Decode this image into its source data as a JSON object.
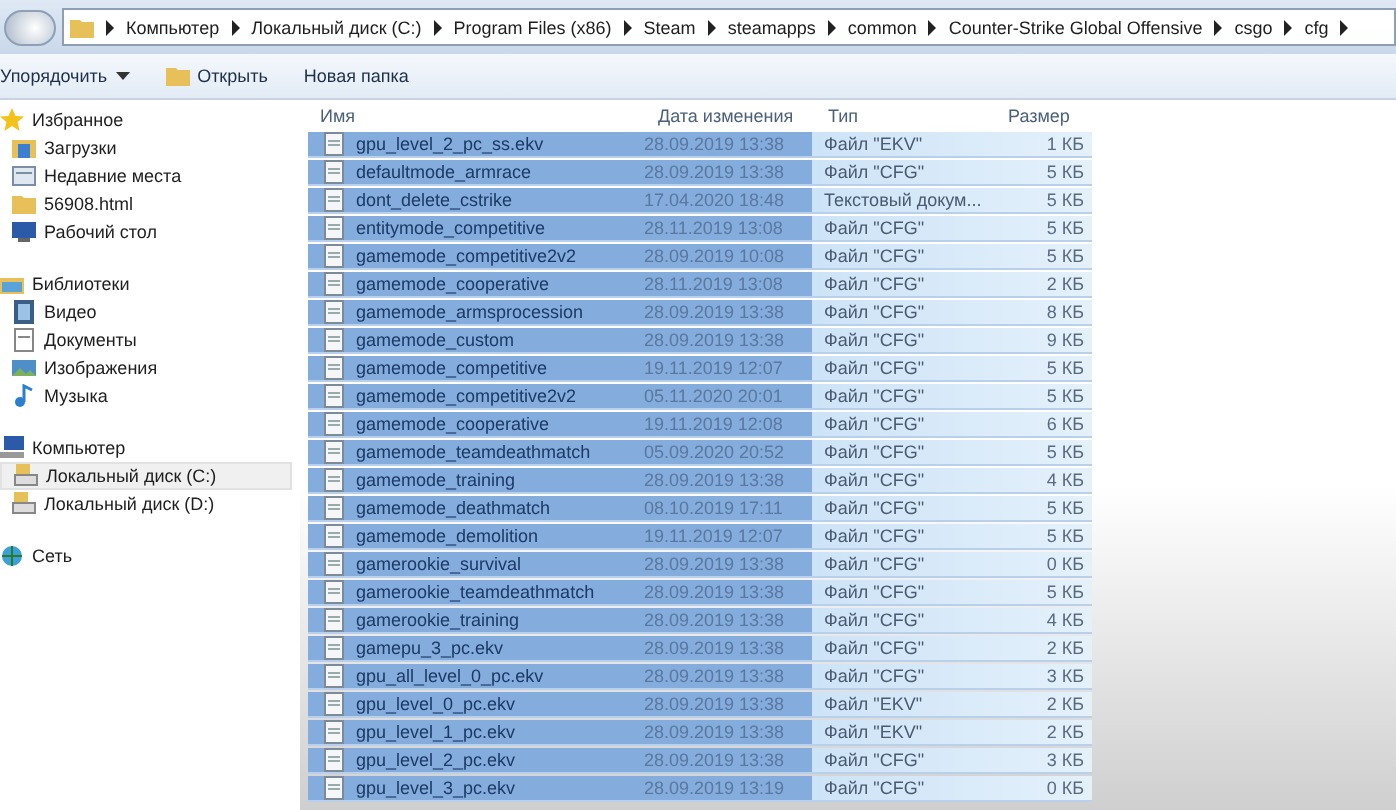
{
  "address_bar": {
    "path": [
      "Компьютер",
      "Локальный диск (C:)",
      "Program Files (x86)",
      "Steam",
      "steamapps",
      "common",
      "Counter-Strike Global Offensive",
      "csgo",
      "cfg"
    ]
  },
  "toolbar": {
    "buttons": [
      {
        "label": "Упорядочить",
        "kind": "menu"
      },
      {
        "label": "Открыть",
        "kind": "open"
      },
      {
        "label": "Новая папка",
        "kind": "plain"
      }
    ]
  },
  "sidebar": {
    "groups": [
      {
        "label": "Избранное",
        "kind": "star",
        "children": [
          {
            "label": "Загрузки",
            "kind": "download",
            "selected": false
          },
          {
            "label": "Недавние места",
            "kind": "recent",
            "selected": false
          },
          {
            "label": "56908.html",
            "kind": "folder",
            "selected": false
          },
          {
            "label": "Рабочий стол",
            "kind": "desktop",
            "selected": false
          }
        ]
      },
      {
        "label": "Библиотеки",
        "kind": "library",
        "children": [
          {
            "label": "Видео",
            "kind": "video",
            "selected": false
          },
          {
            "label": "Документы",
            "kind": "document",
            "selected": false
          },
          {
            "label": "Изображения",
            "kind": "image",
            "selected": false
          },
          {
            "label": "Музыка",
            "kind": "music",
            "selected": false
          }
        ]
      },
      {
        "label": "Компьютер",
        "kind": "computer",
        "children": [
          {
            "label": "Локальный диск (C:)",
            "kind": "drive",
            "selected": true
          },
          {
            "label": "Локальный диск (D:)",
            "kind": "drive",
            "selected": false
          }
        ]
      },
      {
        "label": "Сеть",
        "kind": "network"
      }
    ]
  },
  "table": {
    "columns": [
      "Имя",
      "Дата изменения",
      "Тип",
      "Размер"
    ],
    "rows": [
      {
        "name": "gpu_level_2_pc_ss.ekv",
        "date": "28.09.2019 13:38",
        "type": "Файл \"EKV\"",
        "size": "1 КБ",
        "selected": true
      },
      {
        "name": "defaultmode_armrace",
        "date": "28.09.2019 13:38",
        "type": "Файл \"CFG\"",
        "size": "5 КБ",
        "selected": true
      },
      {
        "name": "dont_delete_cstrike",
        "date": "17.04.2020 18:48",
        "type": "Текстовый докум...",
        "size": "5 КБ",
        "selected": true
      },
      {
        "name": "entitymode_competitive",
        "date": "28.11.2019 13:08",
        "type": "Файл \"CFG\"",
        "size": "5 КБ",
        "selected": true
      },
      {
        "name": "gamemode_competitive2v2",
        "date": "28.09.2019 10:08",
        "type": "Файл \"CFG\"",
        "size": "5 КБ",
        "selected": true
      },
      {
        "name": "gamemode_cooperative",
        "date": "28.11.2019 13:08",
        "type": "Файл \"CFG\"",
        "size": "2 КБ",
        "selected": true
      },
      {
        "name": "gamemode_armsprocession",
        "date": "28.09.2019 13:38",
        "type": "Файл \"CFG\"",
        "size": "8 КБ",
        "selected": true
      },
      {
        "name": "gamemode_custom",
        "date": "28.09.2019 13:38",
        "type": "Файл \"CFG\"",
        "size": "9 КБ",
        "selected": true
      },
      {
        "name": "gamemode_competitive",
        "date": "19.11.2019 12:07",
        "type": "Файл \"CFG\"",
        "size": "5 КБ",
        "selected": true
      },
      {
        "name": "gamemode_competitive2v2",
        "date": "05.11.2020 20:01",
        "type": "Файл \"CFG\"",
        "size": "5 КБ",
        "selected": true
      },
      {
        "name": "gamemode_cooperative",
        "date": "19.11.2019 12:08",
        "type": "Файл \"CFG\"",
        "size": "6 КБ",
        "selected": true
      },
      {
        "name": "gamemode_teamdeathmatch",
        "date": "05.09.2020 20:52",
        "type": "Файл \"CFG\"",
        "size": "5 КБ",
        "selected": true
      },
      {
        "name": "gamemode_training",
        "date": "28.09.2019 13:38",
        "type": "Файл \"CFG\"",
        "size": "4 КБ",
        "selected": true
      },
      {
        "name": "gamemode_deathmatch",
        "date": "08.10.2019 17:11",
        "type": "Файл \"CFG\"",
        "size": "5 КБ",
        "selected": true
      },
      {
        "name": "gamemode_demolition",
        "date": "19.11.2019 12:07",
        "type": "Файл \"CFG\"",
        "size": "5 КБ",
        "selected": true
      },
      {
        "name": "gamerookie_survival",
        "date": "28.09.2019 13:38",
        "type": "Файл \"CFG\"",
        "size": "0 КБ",
        "selected": true
      },
      {
        "name": "gamerookie_teamdeathmatch",
        "date": "28.09.2019 13:38",
        "type": "Файл \"CFG\"",
        "size": "5 КБ",
        "selected": true
      },
      {
        "name": "gamerookie_training",
        "date": "28.09.2019 13:38",
        "type": "Файл \"CFG\"",
        "size": "4 КБ",
        "selected": true
      },
      {
        "name": "gamepu_3_pc.ekv",
        "date": "28.09.2019 13:38",
        "type": "Файл \"CFG\"",
        "size": "2 КБ",
        "selected": true
      },
      {
        "name": "gpu_all_level_0_pc.ekv",
        "date": "28.09.2019 13:38",
        "type": "Файл \"CFG\"",
        "size": "3 КБ",
        "selected": true
      },
      {
        "name": "gpu_level_0_pc.ekv",
        "date": "28.09.2019 13:38",
        "type": "Файл \"EKV\"",
        "size": "2 КБ",
        "selected": true
      },
      {
        "name": "gpu_level_1_pc.ekv",
        "date": "28.09.2019 13:38",
        "type": "Файл \"EKV\"",
        "size": "2 КБ",
        "selected": true
      },
      {
        "name": "gpu_level_2_pc.ekv",
        "date": "28.09.2019 13:38",
        "type": "Файл \"CFG\"",
        "size": "3 КБ",
        "selected": true
      },
      {
        "name": "gpu_level_3_pc.ekv",
        "date": "28.09.2019 13:19",
        "type": "Файл \"CFG\"",
        "size": "0 КБ",
        "selected": true
      }
    ]
  }
}
